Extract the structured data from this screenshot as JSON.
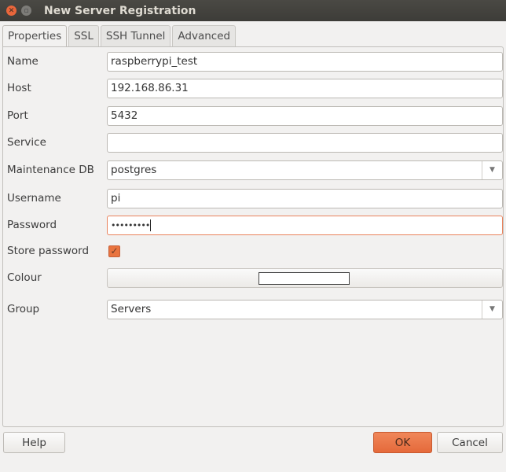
{
  "window": {
    "title": "New Server Registration"
  },
  "tabs": [
    {
      "label": "Properties",
      "active": true
    },
    {
      "label": "SSL",
      "active": false
    },
    {
      "label": "SSH Tunnel",
      "active": false
    },
    {
      "label": "Advanced",
      "active": false
    }
  ],
  "form": {
    "name": {
      "label": "Name",
      "value": "raspberrypi_test"
    },
    "host": {
      "label": "Host",
      "value": "192.168.86.31"
    },
    "port": {
      "label": "Port",
      "value": "5432"
    },
    "service": {
      "label": "Service",
      "value": ""
    },
    "maintenance_db": {
      "label": "Maintenance DB",
      "value": "postgres"
    },
    "username": {
      "label": "Username",
      "value": "pi"
    },
    "password": {
      "label": "Password",
      "value": "•••••••••"
    },
    "store_password": {
      "label": "Store password",
      "checked": true
    },
    "colour": {
      "label": "Colour",
      "value": "#ffffff"
    },
    "group": {
      "label": "Group",
      "value": "Servers"
    }
  },
  "buttons": {
    "help": "Help",
    "ok": "OK",
    "cancel": "Cancel"
  },
  "colors": {
    "accent": "#e9743f",
    "focus_border": "#e9825c"
  }
}
